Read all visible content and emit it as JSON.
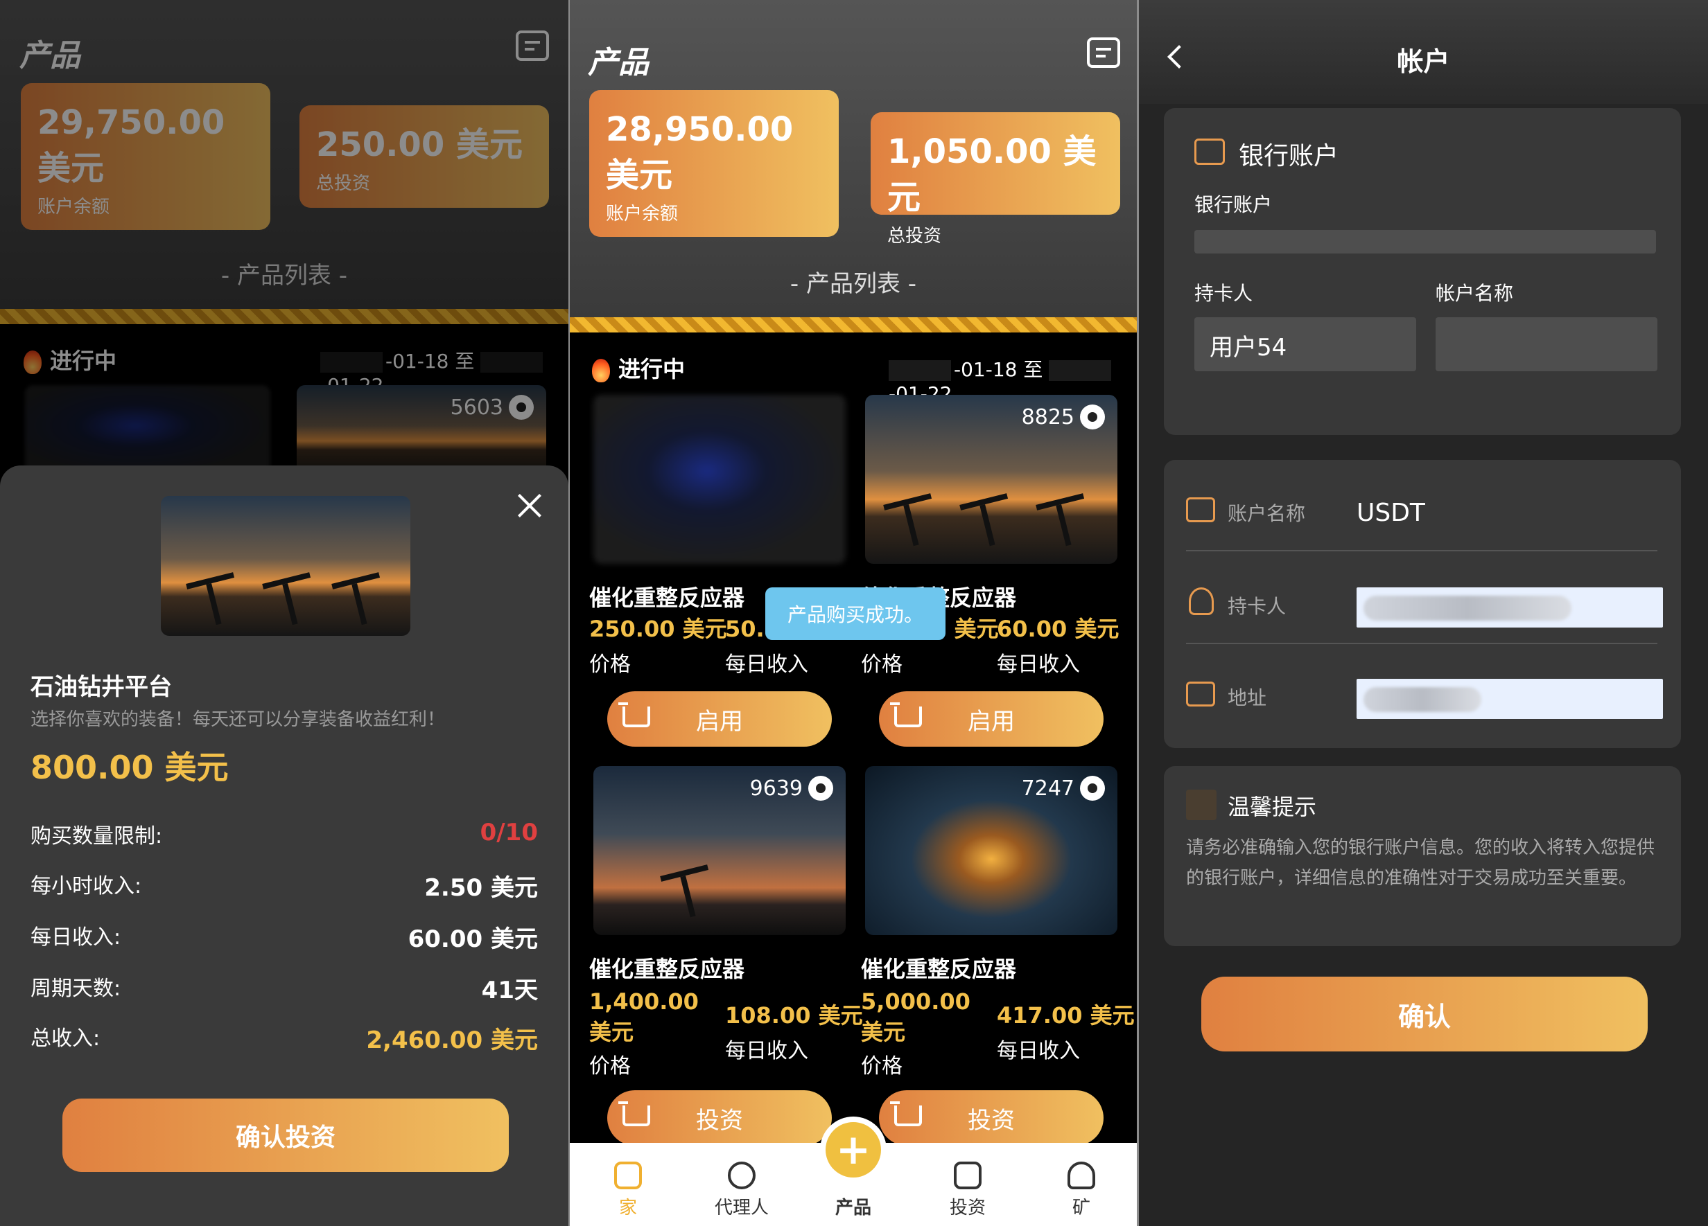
{
  "colors": {
    "accent_start": "#e08040",
    "accent_end": "#f0c060",
    "price": "#f3c04a",
    "limit": "#e04040",
    "toast": "#6ec6ee"
  },
  "p1": {
    "title": "产品",
    "balance": "29,750.00 美元",
    "balance_label": "账户余额",
    "invest": "250.00 美元",
    "invest_label": "总投资",
    "section": "- 产品列表 -",
    "status": "进行中",
    "date_from": "-01-18 至",
    "date_to": "-01-22",
    "views": "5603",
    "modal": {
      "name": "石油钻井平台",
      "desc": "选择你喜欢的装备！每天还可以分享装备收益红利！",
      "price": "800.00 美元",
      "rows": [
        {
          "label": "购买数量限制:",
          "value": "0/10"
        },
        {
          "label": "每小时收入:",
          "value": "2.50 美元"
        },
        {
          "label": "每日收入:",
          "value": "60.00 美元"
        },
        {
          "label": "周期天数:",
          "value": "41天"
        },
        {
          "label": "总收入:",
          "value": "2,460.00 美元"
        }
      ],
      "confirm": "确认投资"
    }
  },
  "p2": {
    "title": "产品",
    "balance": "28,950.00 美元",
    "balance_label": "账户余额",
    "invest": "1,050.00 美元",
    "invest_label": "总投资",
    "section": "- 产品列表 -",
    "status": "进行中",
    "date_from": "-01-18 至",
    "date_to": "-01-22",
    "toast": "产品购买成功。",
    "products": [
      {
        "name": "催化重整反应器",
        "price": "250.00 美元",
        "daily": "50.00 美元",
        "views": "",
        "btn": "启用"
      },
      {
        "name": "催化重整反应器",
        "price": "250.00 美元",
        "daily": "60.00 美元",
        "views": "8825",
        "btn": "启用"
      },
      {
        "name": "催化重整反应器",
        "price": "1,400.00 美元",
        "daily": "108.00 美元",
        "views": "9639",
        "btn": "投资"
      },
      {
        "name": "催化重整反应器",
        "price": "5,000.00 美元",
        "daily": "417.00 美元",
        "views": "7247",
        "btn": "投资"
      }
    ],
    "price_label": "价格",
    "daily_label": "每日收入",
    "nav": [
      "家",
      "代理人",
      "产品",
      "投资",
      "矿"
    ],
    "fab": "+"
  },
  "p3": {
    "title": "帐户",
    "bank_title": "银行账户",
    "bank_label": "银行账户",
    "holder_label": "持卡人",
    "holder_value": "用户54",
    "acct_name_label": "帐户名称",
    "row1_label": "账户名称",
    "row1_value": "USDT",
    "row2_label": "持卡人",
    "row3_label": "地址",
    "tip_title": "温馨提示",
    "tip_text": "请务必准确输入您的银行账户信息。您的收入将转入您提供的银行账户，详细信息的准确性对于交易成功至关重要。",
    "confirm": "确认"
  }
}
